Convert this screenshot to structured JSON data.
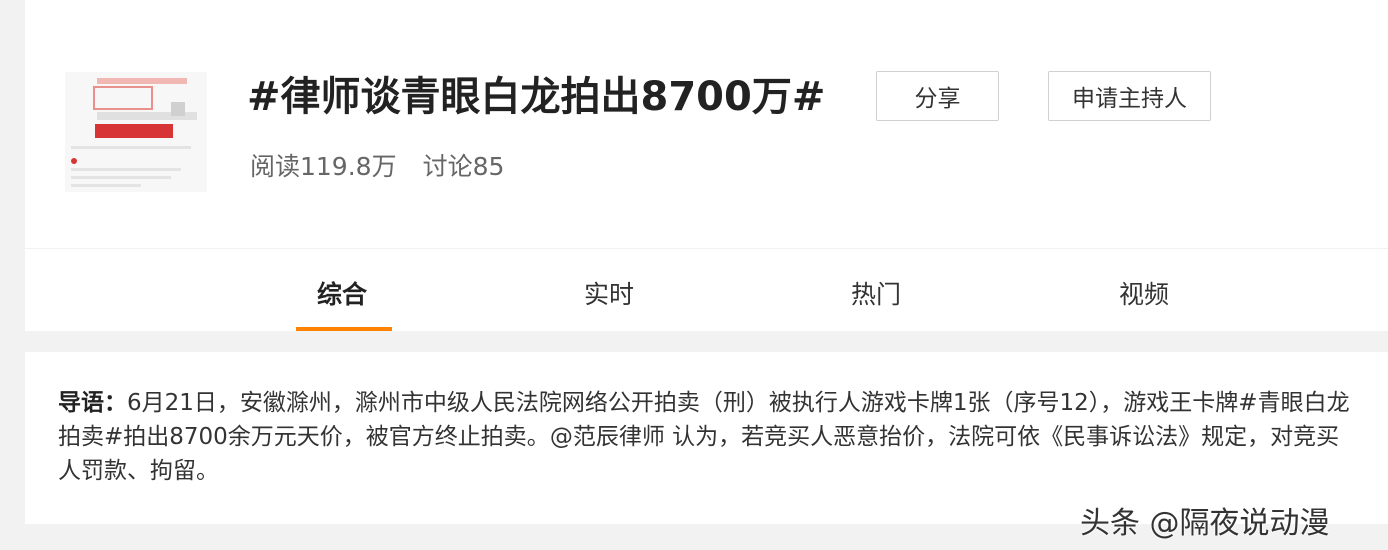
{
  "topic": {
    "title": "#律师谈青眼白龙拍出8700万#",
    "reads": "阅读119.8万",
    "discussions": "讨论85"
  },
  "buttons": {
    "share": "分享",
    "apply_host": "申请主持人"
  },
  "tabs": [
    {
      "label": "综合",
      "active": true
    },
    {
      "label": "实时",
      "active": false
    },
    {
      "label": "热门",
      "active": false
    },
    {
      "label": "视频",
      "active": false
    }
  ],
  "intro": {
    "label": "导语：",
    "text_before_mention": "6月21日，安徽滁州，滁州市中级人民法院网络公开拍卖（刑）被执行人游戏卡牌1张（序号12），游戏王卡牌#青眼白龙拍卖#拍出8700余万元天价，被官方终止拍卖。",
    "mention": "@范辰律师",
    "text_after_mention": " 认为，若竞买人恶意抬价，法院可依《民事诉讼法》规定，对竞买人罚款、拘留。"
  },
  "watermark": "头条 @隔夜说动漫",
  "colors": {
    "accent_tab_underline": "#ff8200",
    "page_background": "#f2f2f2"
  }
}
